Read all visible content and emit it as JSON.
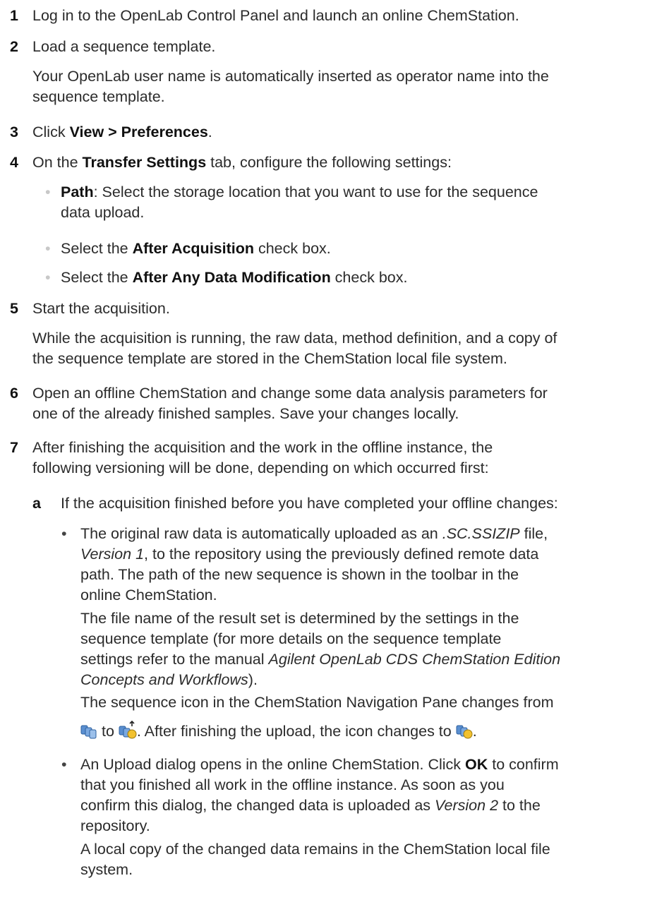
{
  "steps": [
    {
      "num": "1",
      "text": "Log in to the OpenLab Control Panel and launch an online ChemStation."
    },
    {
      "num": "2",
      "text": "Load a sequence template.",
      "note": [
        "Your OpenLab user name is automatically inserted as operator name into the",
        "sequence template."
      ]
    },
    {
      "num": "3",
      "pre": "Click ",
      "bold": "View > Preferences",
      "post": "."
    },
    {
      "num": "4",
      "pre": "On the ",
      "bold": "Transfer Settings",
      "post": " tab, configure the following settings:",
      "bullets": [
        {
          "bold": "Path",
          "text_l1": ": Select the storage location that you want to use for the sequence",
          "text_l2": "data upload."
        },
        {
          "pre": "Select the ",
          "bold": "After Acquisition",
          "post": " check box."
        },
        {
          "pre": "Select the ",
          "bold": "After Any Data Modification",
          "post": " check box."
        }
      ]
    },
    {
      "num": "5",
      "text": "Start the acquisition.",
      "note": [
        "While the acquisition is running, the raw data, method definition, and a copy of",
        "the sequence template are stored in the ChemStation local file system."
      ]
    },
    {
      "num": "6",
      "lines": [
        "Open an offline ChemStation and change some data analysis parameters for",
        "one of the already finished samples. Save your changes locally."
      ]
    },
    {
      "num": "7",
      "lines": [
        "After finishing the acquisition and the work in the offline instance, the",
        "following versioning will be done, depending on which occurred first:"
      ],
      "sub": {
        "letter": "a",
        "text": "If the acquisition finished before you have completed your offline changes:",
        "b1": {
          "l1_pre": "The original raw data is automatically uploaded as an ",
          "l1_ital": ".SC.SSIZIP",
          "l1_post": " file,",
          "l2_ital": "Version 1",
          "l2_post": ", to the repository using the previously defined remote data",
          "l3": "path. The path of the new sequence is shown in the toolbar in the",
          "l4": "online ChemStation.",
          "p2_l1": "The file name of the result set is determined by the settings in the",
          "p2_l2": "sequence template (for more details on the sequence template",
          "p2_l3_pre": "settings refer to the manual ",
          "p2_l3_ital": "Agilent OpenLab CDS ChemStation Edition",
          "p2_l4_ital": "Concepts and Workflows",
          "p2_l4_post": ").",
          "p3_l1": "The sequence icon in the ChemStation Navigation Pane changes from",
          "p3_to": "to",
          "p3_mid": ". After finishing the upload, the icon changes to",
          "p3_end": "."
        },
        "b2": {
          "l1_pre": "An Upload dialog opens in the online ChemStation. Click ",
          "l1_bold": "OK",
          "l1_post": " to confirm",
          "l2": "that you finished all work in the offline instance. As soon as you",
          "l3_pre": "confirm this dialog, the changed data is uploaded as ",
          "l3_ital": "Version 2",
          "l3_post": " to the",
          "l4": "repository.",
          "p2_l1": "A local copy of the changed data remains in the ChemStation local file",
          "p2_l2": "system."
        }
      }
    }
  ],
  "bullet_glyph": "•",
  "icons": [
    "sequence-icon",
    "sequence-uploading-icon",
    "sequence-uploaded-icon"
  ]
}
